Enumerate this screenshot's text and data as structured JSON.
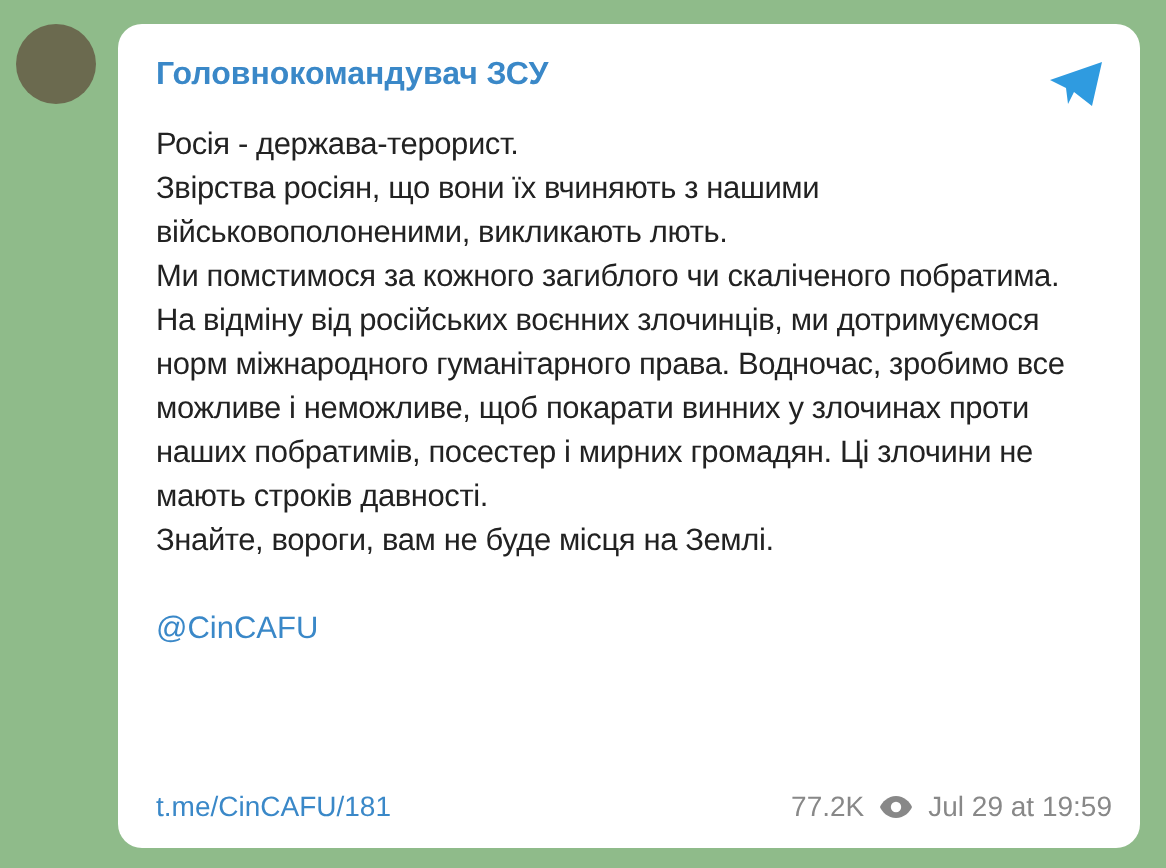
{
  "post": {
    "channel": "Головнокомандувач ЗСУ",
    "paragraphs": [
      "Росія - держава-терорист.",
      "Звірства росіян, що вони їх вчиняють з нашими військовополоненими, викликають лють.",
      "Ми помстимося за кожного загиблого чи скаліченого побратима.",
      "На відміну від російських воєнних злочинців, ми дотримуємося норм міжнародного гуманітарного права. Водночас, зробимо все можливе і неможливе, щоб покарати винних у злочинах проти наших побратимів, посестер і мирних громадян. Ці злочини не мають строків давності.",
      "Знайте, вороги, вам не буде місця на Землі."
    ],
    "signature": "@CinCAFU",
    "link": "t.me/CinCAFU/181",
    "views": "77.2K",
    "date": "Jul 29 at 19:59"
  }
}
